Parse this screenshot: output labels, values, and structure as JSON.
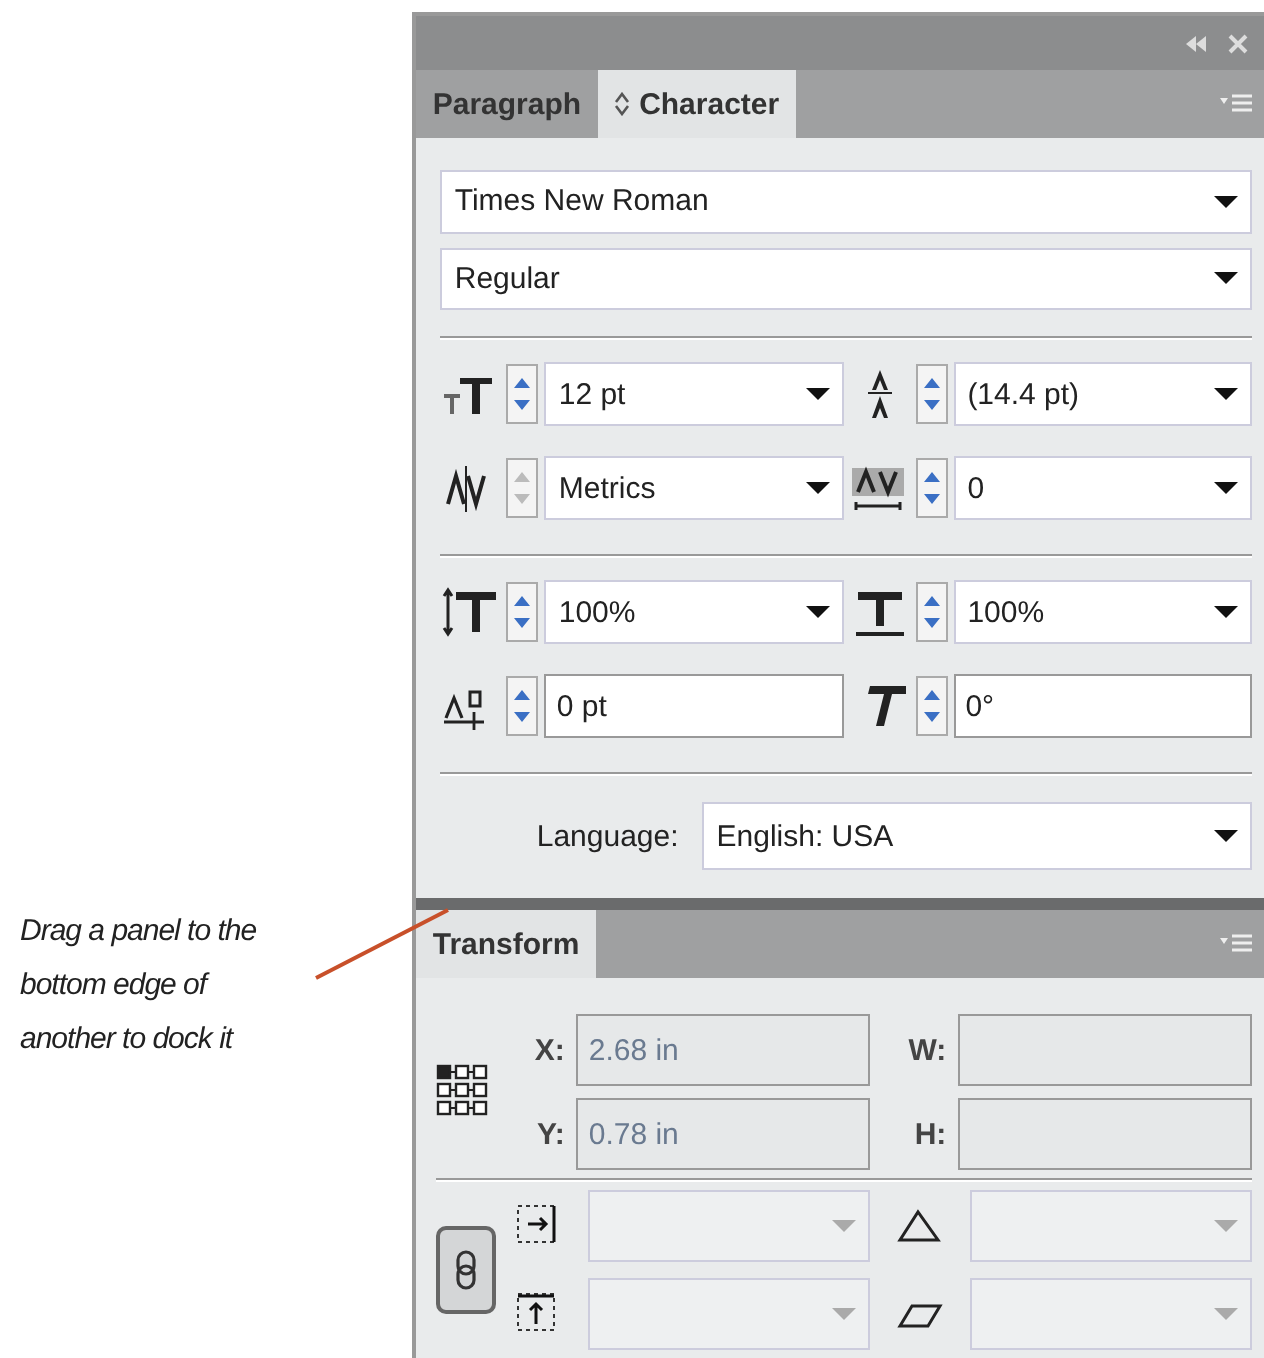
{
  "callout": {
    "text": "Drag a panel to the bottom edge of another to dock it"
  },
  "character_panel": {
    "tabs": [
      {
        "label": "Paragraph",
        "selected": false,
        "stepper": false
      },
      {
        "label": "Character",
        "selected": true,
        "stepper": true
      }
    ],
    "font_family": "Times New Roman",
    "font_style": "Regular",
    "fields": [
      {
        "value": "12 pt",
        "kind": "dropdown",
        "disabled": false
      },
      {
        "value": "(14.4 pt)",
        "kind": "dropdown",
        "disabled": false
      },
      {
        "value": "Metrics",
        "kind": "dropdown",
        "disabled": true
      },
      {
        "value": "0",
        "kind": "dropdown",
        "disabled": false
      },
      {
        "value": "100%",
        "kind": "dropdown",
        "disabled": false
      },
      {
        "value": "100%",
        "kind": "dropdown",
        "disabled": false
      },
      {
        "value": "0 pt",
        "kind": "text",
        "disabled": false
      },
      {
        "value": "0°",
        "kind": "text",
        "disabled": false
      }
    ],
    "language": {
      "label": "Language:",
      "value": "English: USA"
    }
  },
  "transform_panel": {
    "tab": {
      "label": "Transform",
      "selected": true
    },
    "fields": [
      {
        "label": "X:",
        "value": "2.68 in"
      },
      {
        "label": "W:"
      },
      {
        "label": "Y:",
        "value": "0.78 in"
      },
      {
        "label": "H:"
      }
    ],
    "dropdowns": [
      {
        "disabled": true
      },
      {
        "disabled": true
      },
      {
        "disabled": true
      },
      {
        "disabled": true
      }
    ]
  }
}
